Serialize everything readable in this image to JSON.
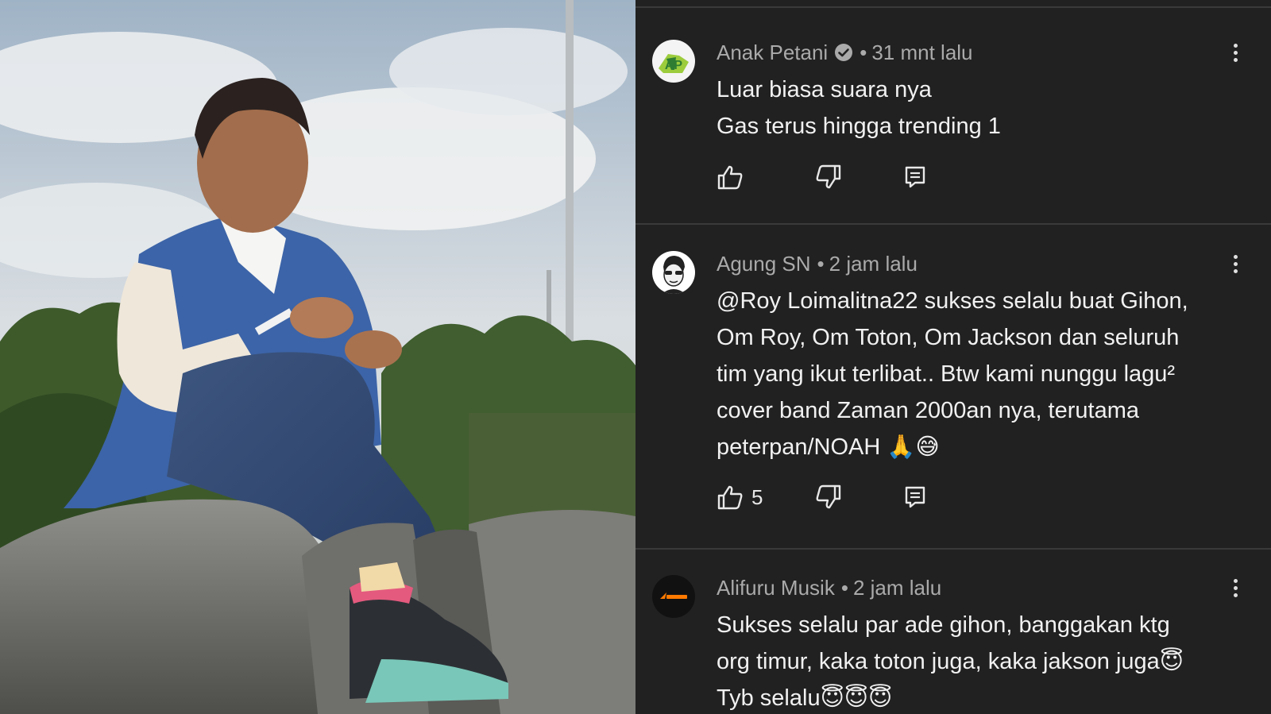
{
  "comments": [
    {
      "author": "Anak Petani",
      "verified": true,
      "separator": "•",
      "time": "31 mnt lalu",
      "lines": [
        "Luar biasa suara nya",
        "Gas terus hingga trending 1"
      ],
      "likes": "",
      "avatar_colors": [
        "#9ccc3c",
        "#2e7d32",
        "#f4f4f4"
      ]
    },
    {
      "author": "Agung SN",
      "verified": false,
      "separator": "•",
      "time": "2 jam lalu",
      "lines": [
        "@Roy Loimalitna22  sukses selalu buat Gihon,",
        "Om Roy, Om Toton, Om Jackson dan seluruh",
        "tim yang ikut terlibat.. Btw kami nunggu lagu²",
        "cover band Zaman 2000an nya, terutama",
        "peterpan/NOAH 🙏😅"
      ],
      "likes": "5",
      "avatar_colors": [
        "#ffffff",
        "#222222"
      ]
    },
    {
      "author": "Alifuru Musik",
      "verified": false,
      "separator": "•",
      "time": "2 jam lalu",
      "lines": [
        "Sukses selalu par ade gihon, banggakan ktg",
        "org timur, kaka toton juga, kaka jakson juga😇",
        "Tyb selalu😇😇😇"
      ],
      "likes": "",
      "avatar_colors": [
        "#111111",
        "#ff7a00"
      ]
    }
  ],
  "icons": {
    "like": "thumbs-up-icon",
    "dislike": "thumbs-down-icon",
    "reply": "reply-icon",
    "menu": "more-vert-icon",
    "verified": "verified-check-icon"
  },
  "colors": {
    "panel_bg": "#212121",
    "author": "#aaaaaa",
    "text": "#f1f1f1",
    "divider": "#3a3a3a"
  }
}
